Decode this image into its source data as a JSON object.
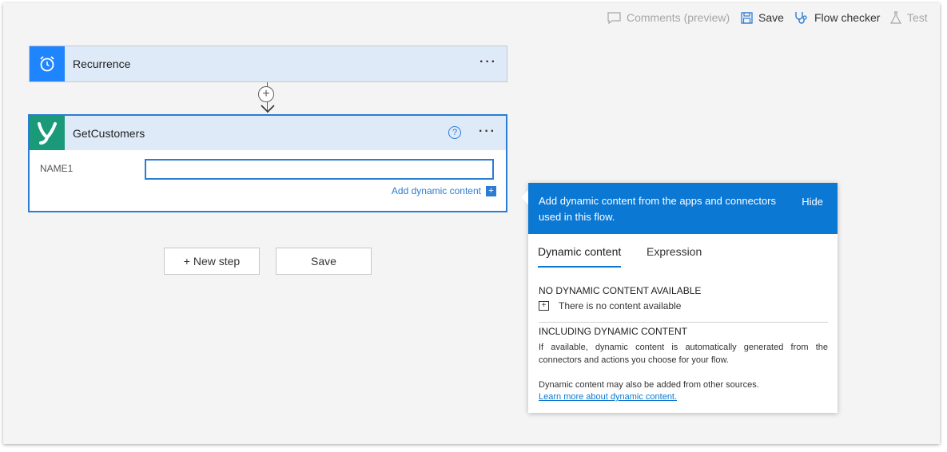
{
  "toolbar": {
    "comments_label": "Comments (preview)",
    "save_label": "Save",
    "flow_checker_label": "Flow checker",
    "test_label": "Test"
  },
  "steps": {
    "recurrence": {
      "title": "Recurrence",
      "more": "···"
    },
    "get_customers": {
      "title": "GetCustomers",
      "help": "?",
      "more": "···",
      "field_label": "NAME1",
      "field_value": "",
      "add_dynamic_label": "Add dynamic content",
      "add_dynamic_icon": "+"
    }
  },
  "connector": {
    "plus": "+"
  },
  "actions": {
    "new_step_label": "+ New step",
    "save_label": "Save"
  },
  "dynamic_panel": {
    "header_text": "Add dynamic content from the apps and connectors used in this flow.",
    "hide_label": "Hide",
    "tabs": [
      {
        "label": "Dynamic content",
        "active": true
      },
      {
        "label": "Expression",
        "active": false
      }
    ],
    "no_content_title": "NO DYNAMIC CONTENT AVAILABLE",
    "no_content_icon": "+",
    "no_content_text": "There is no content available",
    "including_title": "INCLUDING DYNAMIC CONTENT",
    "including_text": "If available, dynamic content is automatically generated from the connectors and actions you choose for your flow.",
    "other_sources_text": "Dynamic content may also be added from other sources.",
    "learn_more_link": "Learn more about dynamic content."
  },
  "colors": {
    "accent": "#0b78d4",
    "recurrence_icon_bg": "#1f85ff",
    "connector_icon_bg": "#1b9a7a",
    "card_header_bg": "#dfeaf8"
  }
}
